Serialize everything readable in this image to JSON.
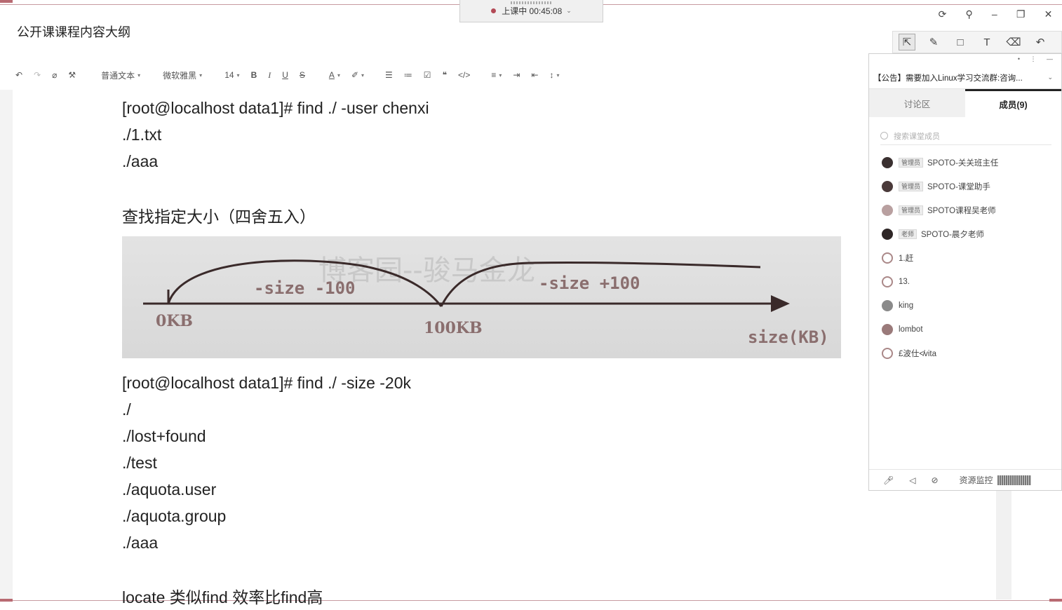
{
  "document": {
    "title": "公开课课程内容大纲"
  },
  "class_status": {
    "label": "上课中 00:45:08"
  },
  "editor_toolbar": {
    "paragraph_style": "普通文本",
    "font_family": "微软雅黑",
    "font_size": "14",
    "bold": "B",
    "italic": "I",
    "underline": "U",
    "strike": "S",
    "font_color": "A"
  },
  "content": {
    "cmd1": "[root@localhost data1]# find ./ -user chenxi",
    "out1": [
      "./1.txt",
      "./aaa"
    ],
    "heading_size": "查找指定大小（四舍五入）",
    "figure": {
      "watermark": "博客园--骏马金龙",
      "label_minus": "-size  -100",
      "label_plus": "-size  +100",
      "tick_0": "0KB",
      "tick_100": "100KB",
      "axis_label": "size(KB)"
    },
    "cmd2": "[root@localhost data1]# find ./ -size -20k",
    "out2": [
      "./",
      "./lost+found",
      "./test",
      "./aquota.user",
      "./aquota.group",
      "./aaa"
    ],
    "heading_locate": "locate 类似find 效率比find高"
  },
  "side_panel": {
    "announcement": "【公告】需要加入Linux学习交流群:咨询...",
    "tabs": {
      "discussion": "讨论区",
      "members": "成员(9)"
    },
    "search_placeholder": "搜索课堂成员",
    "members": [
      {
        "role": "管理员",
        "name": "SPOTO-关关班主任"
      },
      {
        "role": "管理员",
        "name": "SPOTO-课堂助手"
      },
      {
        "role": "管理员",
        "name": "SPOTO课程吴老师"
      },
      {
        "role": "老师",
        "name": "SPOTO-晨夕老师"
      },
      {
        "role": "",
        "name": "1.赶"
      },
      {
        "role": "",
        "name": "13."
      },
      {
        "role": "",
        "name": "king"
      },
      {
        "role": "",
        "name": "lombot"
      },
      {
        "role": "",
        "name": "£波仕≮vita"
      }
    ],
    "footer": {
      "monitor": "资源监控"
    }
  }
}
